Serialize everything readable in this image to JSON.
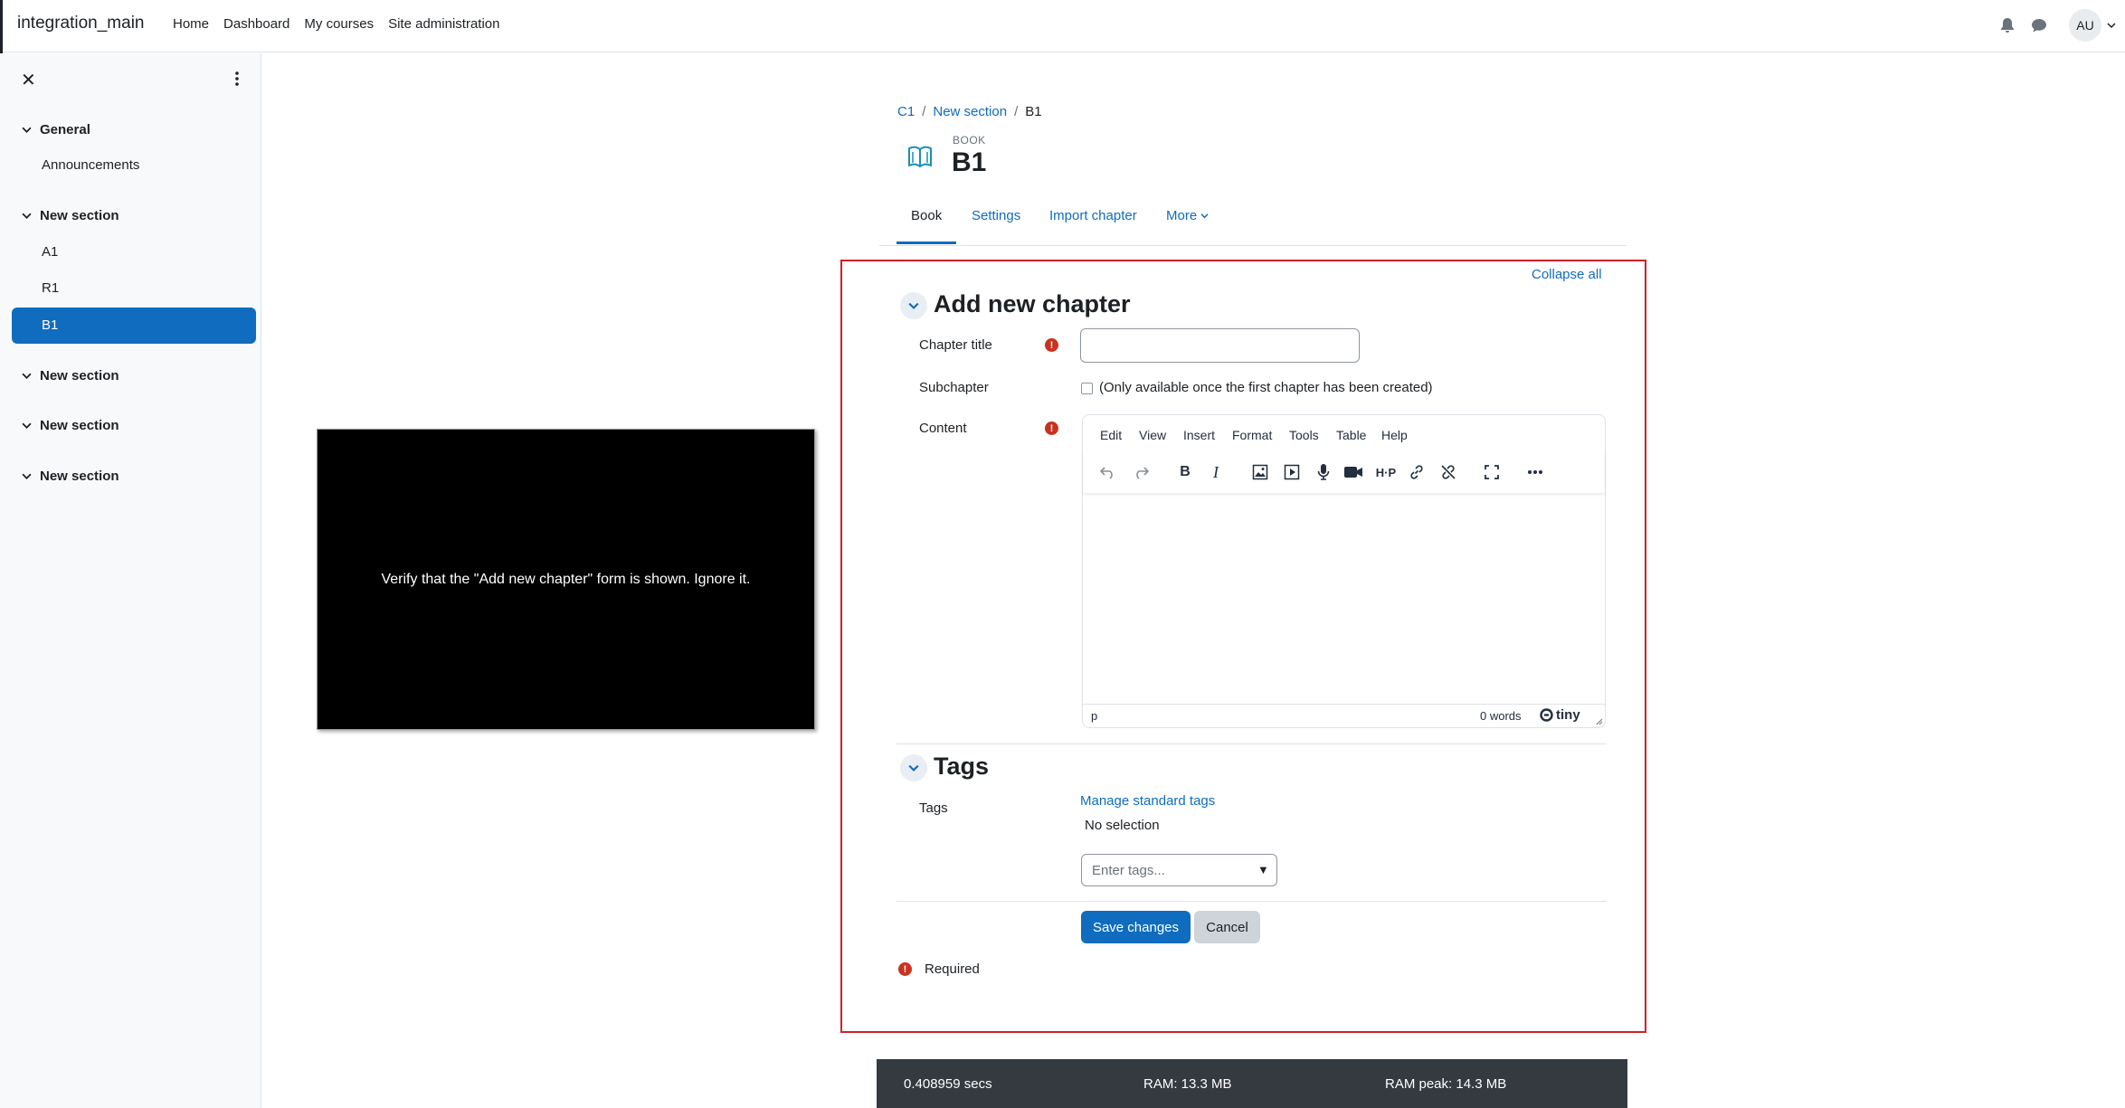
{
  "navbar": {
    "site_name": "integration_main",
    "links": [
      "Home",
      "Dashboard",
      "My courses",
      "Site administration"
    ],
    "avatar_initials": "AU"
  },
  "drawer": {
    "sections": [
      {
        "title": "General",
        "items": [
          "Announcements"
        ]
      },
      {
        "title": "New section",
        "items": [
          "A1",
          "R1",
          "B1"
        ]
      },
      {
        "title": "New section",
        "items": []
      },
      {
        "title": "New section",
        "items": []
      },
      {
        "title": "New section",
        "items": []
      }
    ],
    "active_item": "B1"
  },
  "video": {
    "caption": "Verify that the \"Add new chapter\" form is shown. Ignore it."
  },
  "breadcrumb": [
    "C1",
    "New section",
    "B1"
  ],
  "activity": {
    "kicker": "BOOK",
    "title": "B1"
  },
  "tabs": [
    "Book",
    "Settings",
    "Import chapter",
    "More"
  ],
  "form": {
    "collapse_all": "Collapse all",
    "section_title": "Add new chapter",
    "chapter_title_label": "Chapter title",
    "chapter_title_value": "",
    "subchapter_label": "Subchapter",
    "subchapter_text": "(Only available once the first chapter has been created)",
    "content_label": "Content",
    "editor": {
      "menu": [
        "Edit",
        "View",
        "Insert",
        "Format",
        "Tools",
        "Table",
        "Help"
      ],
      "status_path": "p",
      "word_count": "0 words",
      "brand": "tiny"
    },
    "tags_section_title": "Tags",
    "tags_label": "Tags",
    "manage_tags": "Manage standard tags",
    "no_selection": "No selection",
    "tags_placeholder": "Enter tags...",
    "save_button": "Save changes",
    "cancel_button": "Cancel",
    "required_note": "Required"
  },
  "performance": {
    "time": "0.408959 secs",
    "ram": "RAM: 13.3 MB",
    "ram_peak": "RAM peak: 14.3 MB"
  },
  "colors": {
    "primary": "#0f6cbf",
    "required": "#ca3120",
    "highlight_frame": "#d1202a"
  }
}
